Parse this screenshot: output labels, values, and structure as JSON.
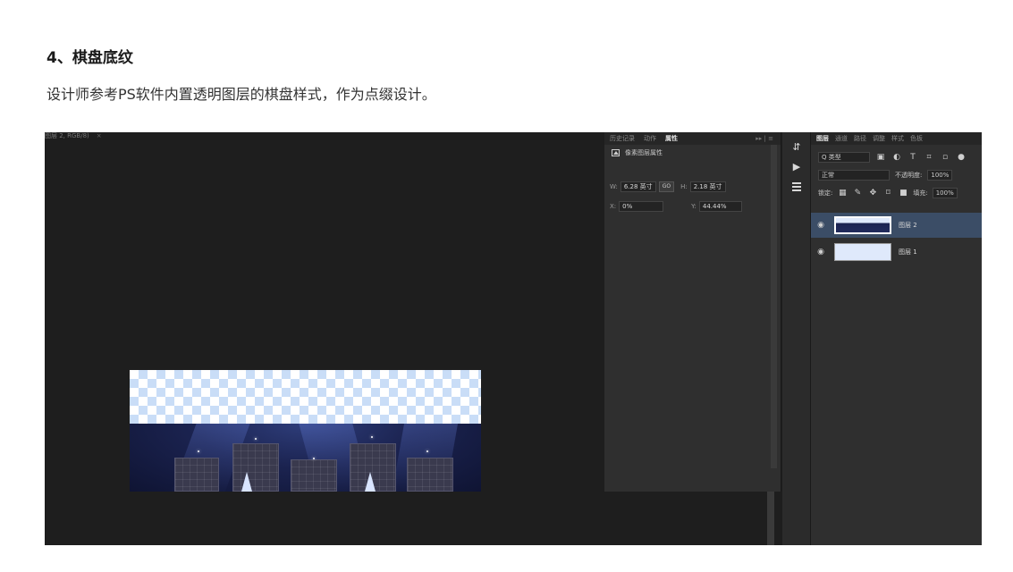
{
  "article": {
    "heading": "4、棋盘底纹",
    "description": "设计师参考PS软件内置透明图层的棋盘样式，作为点缀设计。"
  },
  "document_tab": {
    "title": "图层 2, RGB/8)",
    "close": "×"
  },
  "properties_panel": {
    "tabs": [
      "历史记录",
      "动作",
      "属性"
    ],
    "active_tab": "属性",
    "controls": "▸▸ | ≡",
    "subtitle": "像素图层属性",
    "w_label": "W:",
    "w_value": "6.28 英寸",
    "link_label": "GO",
    "h_label": "H:",
    "h_value": "2.18 英寸",
    "x_label": "X:",
    "x_value": "0%",
    "y_label": "Y:",
    "y_value": "44.44%"
  },
  "layers_panel": {
    "tabs": [
      "图层",
      "通道",
      "路径",
      "调整",
      "样式",
      "色板"
    ],
    "active_tab": "图层",
    "filter_label": "Q 类型",
    "blend_mode": "正常",
    "opacity_label": "不透明度:",
    "opacity_value": "100%",
    "lock_label": "锁定:",
    "fill_label": "填充:",
    "fill_value": "100%",
    "layers": [
      {
        "name": "图层 2",
        "selected": true
      },
      {
        "name": "图层 1",
        "selected": false
      }
    ]
  },
  "icons": {
    "eye": "◉",
    "play": "▶",
    "history": "⇵"
  }
}
